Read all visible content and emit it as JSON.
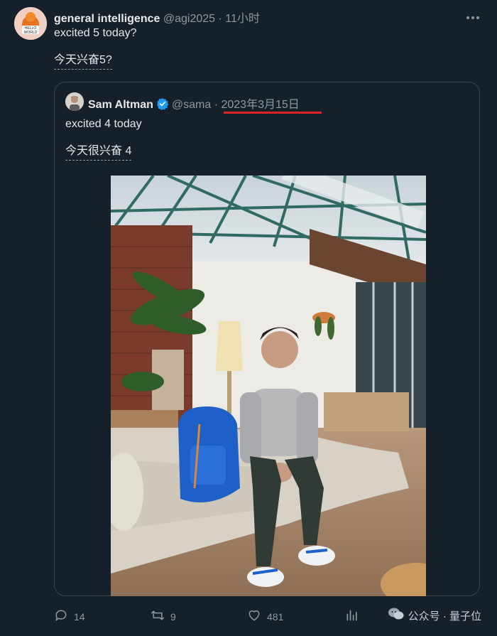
{
  "tweet": {
    "author_name": "general intelligence",
    "handle": "@agi2025",
    "separator": "·",
    "time": "11小时",
    "text": "excited 5 today?",
    "translation": "今天兴奋5?"
  },
  "quote": {
    "author_name": "Sam Altman",
    "handle": "@sama",
    "separator": "·",
    "date": "2023年3月15日",
    "text": "excited 4 today",
    "translation": "今天很兴奋 4"
  },
  "actions": {
    "replies": "14",
    "retweets": "9",
    "likes": "481"
  },
  "watermark": "公众号 · 量子位",
  "colors": {
    "background": "#15202b",
    "verified": "#1d9bf0",
    "highlight": "#e0212a"
  },
  "icons": [
    "more-icon",
    "verified-badge-icon",
    "reply-icon",
    "retweet-icon",
    "like-icon",
    "analytics-icon",
    "wechat-icon"
  ]
}
